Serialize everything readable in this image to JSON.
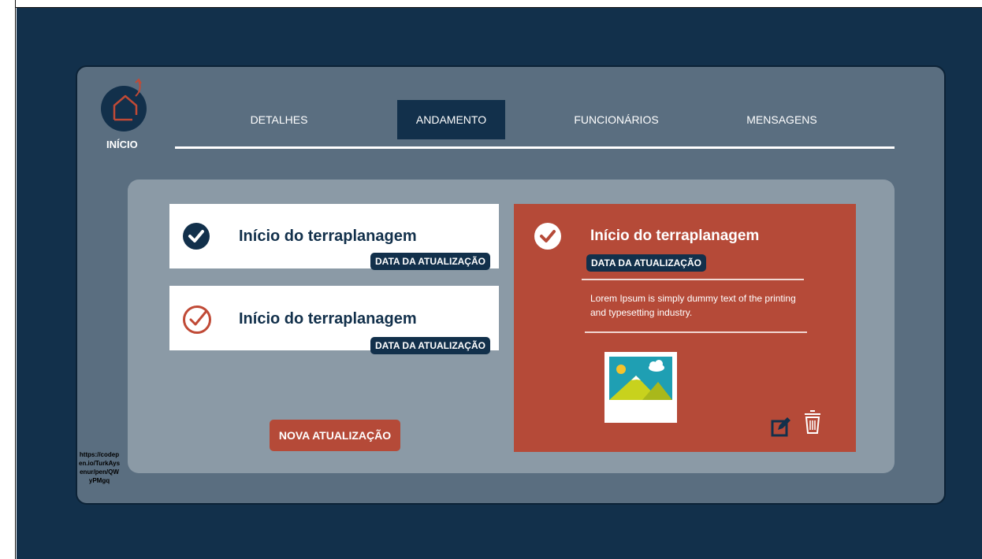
{
  "nav": {
    "home_label": "INÍCIO"
  },
  "tabs": [
    {
      "label": "DETALHES",
      "active": false
    },
    {
      "label": "ANDAMENTO",
      "active": true
    },
    {
      "label": "FUNCIONÁRIOS",
      "active": false
    },
    {
      "label": "MENSAGENS",
      "active": false
    }
  ],
  "updates": [
    {
      "title": "Início do terraplanagem",
      "badge": "DATA DA ATUALIZAÇÃO",
      "status_icon": "check-filled-icon"
    },
    {
      "title": "Início do terraplanagem",
      "badge": "DATA DA ATUALIZAÇÃO",
      "status_icon": "check-outline-icon"
    }
  ],
  "new_update_label": "NOVA ATUALIZAÇÃO",
  "detail": {
    "title": "Início do terraplanagem",
    "badge": "DATA DA ATUALIZAÇÃO",
    "description": "Lorem Ipsum is simply dummy text of the printing and typesetting industry.",
    "image_icon": "landscape-image-icon",
    "edit_icon": "edit-icon",
    "delete_icon": "trash-icon"
  },
  "codepen_url": "https://codepen.io/TurkAysenur/pen/QWyPMgq",
  "colors": {
    "background": "#12304b",
    "app": "#5a6e80",
    "panel": "#8b9aa6",
    "accent": "#b54a38",
    "navy": "#12304b"
  }
}
